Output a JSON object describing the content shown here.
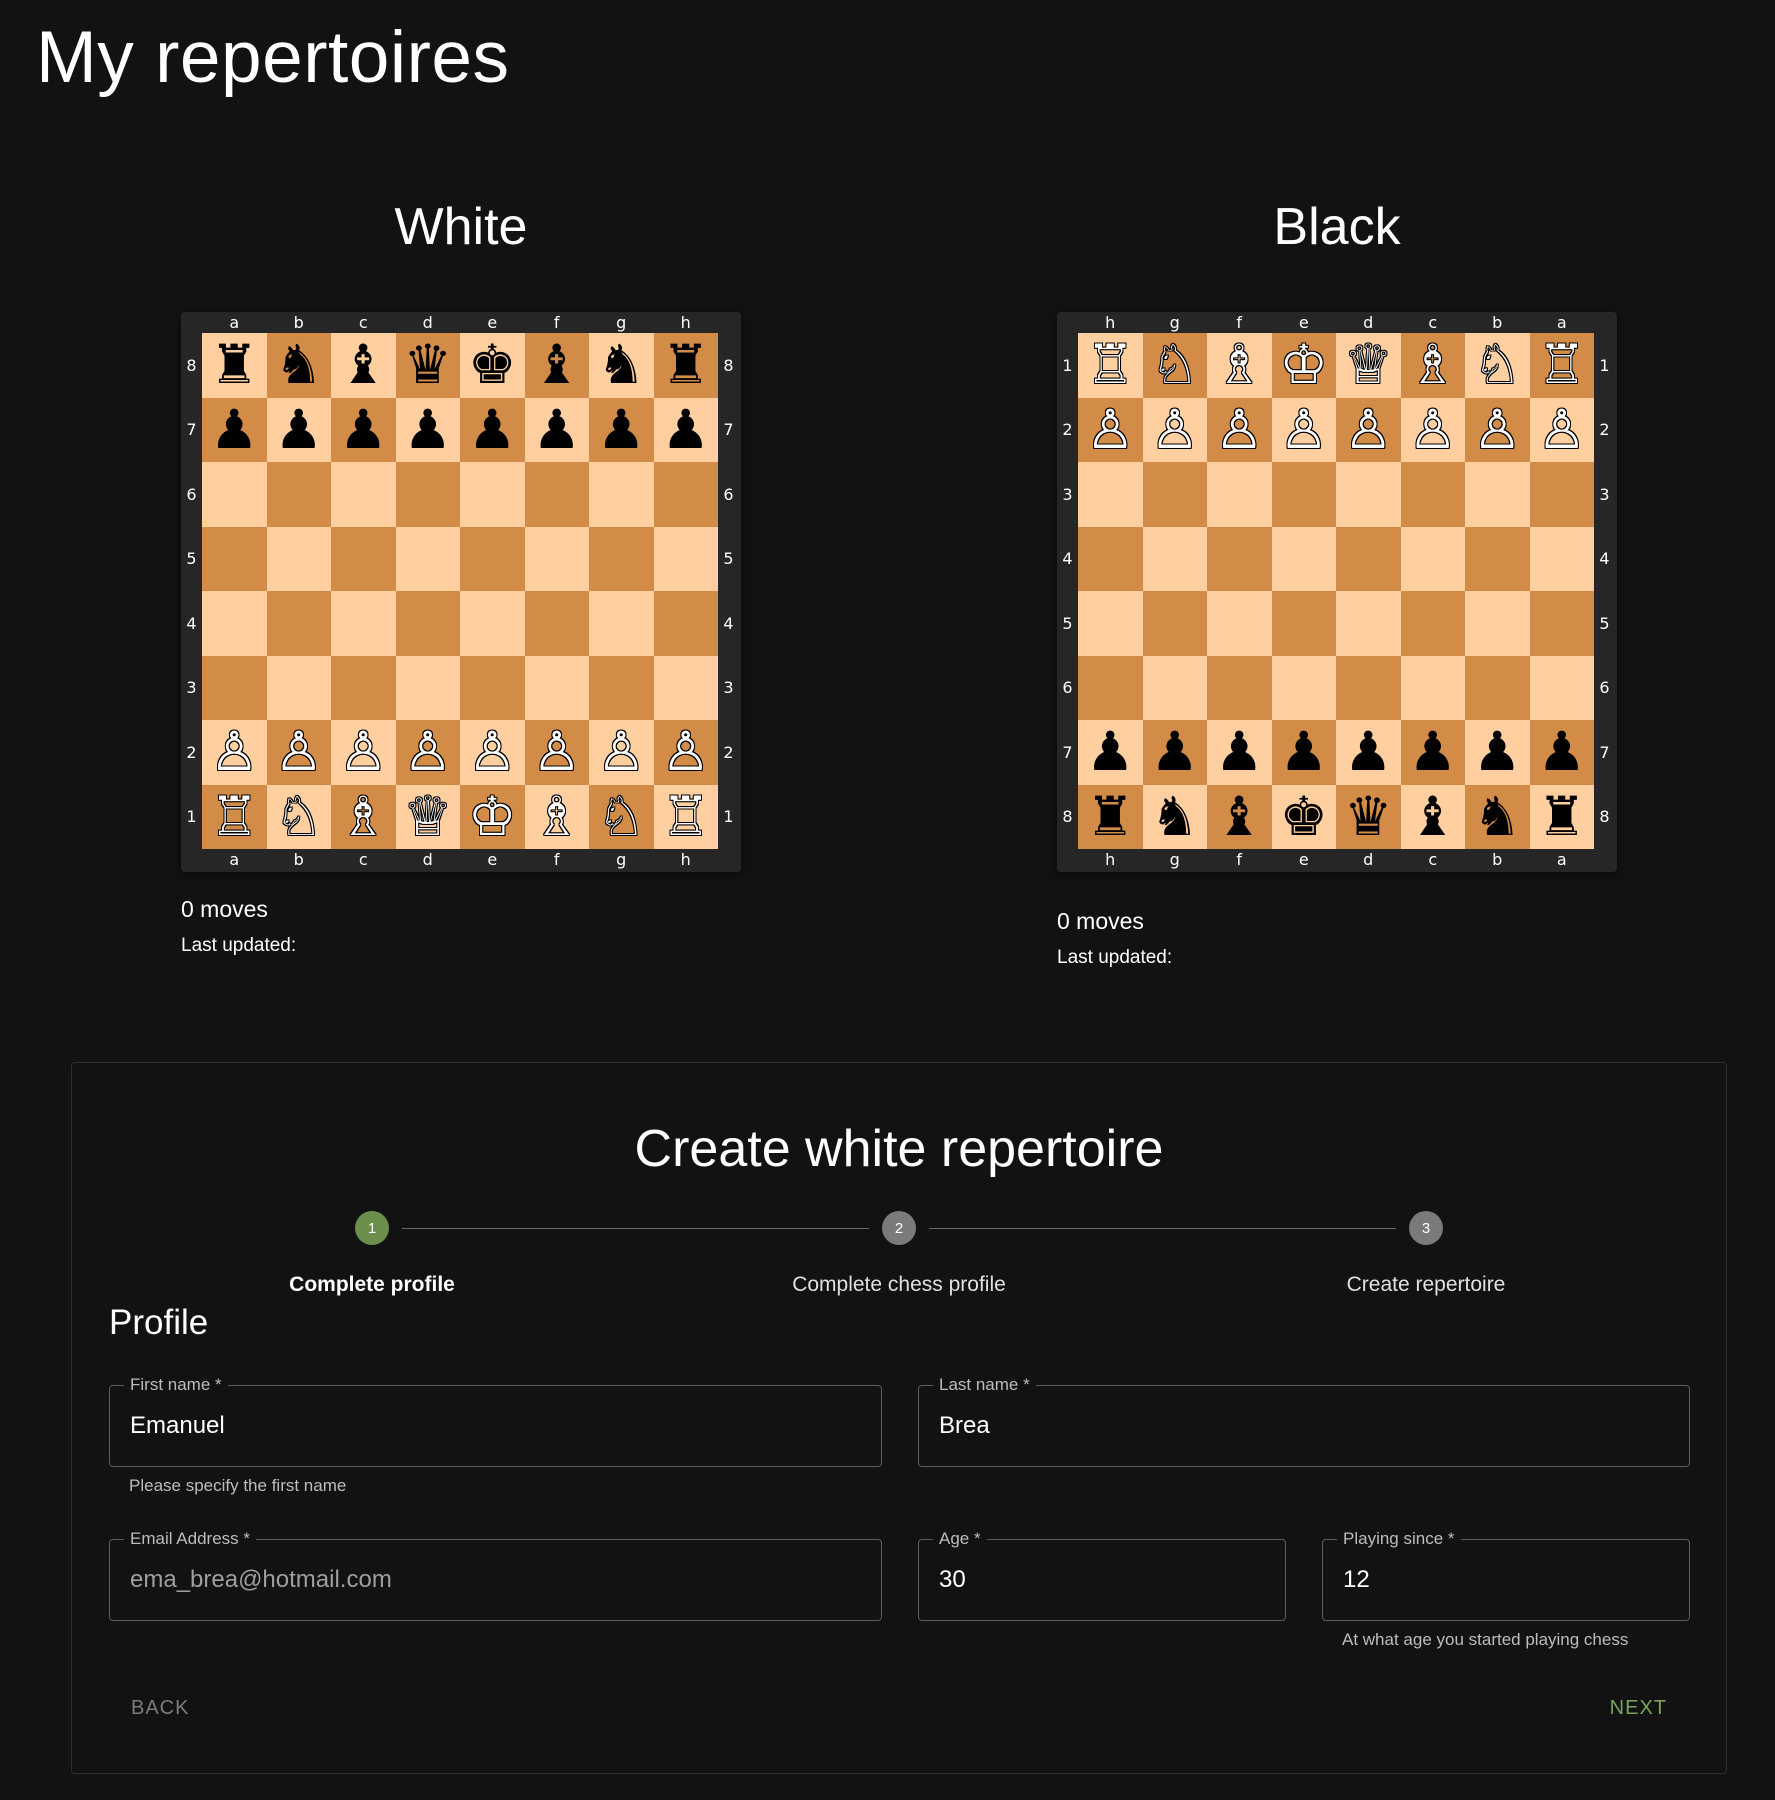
{
  "page": {
    "title": "My repertoires"
  },
  "repertoires": [
    {
      "id": "white",
      "title": "White",
      "orientation": "white",
      "files": [
        "a",
        "b",
        "c",
        "d",
        "e",
        "f",
        "g",
        "h"
      ],
      "ranks": [
        "8",
        "7",
        "6",
        "5",
        "4",
        "3",
        "2",
        "1"
      ],
      "position": [
        [
          "bR",
          "bN",
          "bB",
          "bQ",
          "bK",
          "bB",
          "bN",
          "bR"
        ],
        [
          "bP",
          "bP",
          "bP",
          "bP",
          "bP",
          "bP",
          "bP",
          "bP"
        ],
        [
          "",
          "",
          "",
          "",
          "",
          "",
          "",
          ""
        ],
        [
          "",
          "",
          "",
          "",
          "",
          "",
          "",
          ""
        ],
        [
          "",
          "",
          "",
          "",
          "",
          "",
          "",
          ""
        ],
        [
          "",
          "",
          "",
          "",
          "",
          "",
          "",
          ""
        ],
        [
          "wP",
          "wP",
          "wP",
          "wP",
          "wP",
          "wP",
          "wP",
          "wP"
        ],
        [
          "wR",
          "wN",
          "wB",
          "wQ",
          "wK",
          "wB",
          "wN",
          "wR"
        ]
      ],
      "moves": "0 moves",
      "last_updated": "Last updated:"
    },
    {
      "id": "black",
      "title": "Black",
      "orientation": "black",
      "files": [
        "h",
        "g",
        "f",
        "e",
        "d",
        "c",
        "b",
        "a"
      ],
      "ranks": [
        "1",
        "2",
        "3",
        "4",
        "5",
        "6",
        "7",
        "8"
      ],
      "position": [
        [
          "wR",
          "wN",
          "wB",
          "wK",
          "wQ",
          "wB",
          "wN",
          "wR"
        ],
        [
          "wP",
          "wP",
          "wP",
          "wP",
          "wP",
          "wP",
          "wP",
          "wP"
        ],
        [
          "",
          "",
          "",
          "",
          "",
          "",
          "",
          ""
        ],
        [
          "",
          "",
          "",
          "",
          "",
          "",
          "",
          ""
        ],
        [
          "",
          "",
          "",
          "",
          "",
          "",
          "",
          ""
        ],
        [
          "",
          "",
          "",
          "",
          "",
          "",
          "",
          ""
        ],
        [
          "bP",
          "bP",
          "bP",
          "bP",
          "bP",
          "bP",
          "bP",
          "bP"
        ],
        [
          "bR",
          "bN",
          "bB",
          "bK",
          "bQ",
          "bB",
          "bN",
          "bR"
        ]
      ],
      "moves": "0 moves",
      "last_updated": "Last updated:"
    }
  ],
  "create_form": {
    "title": "Create white repertoire",
    "steps": [
      {
        "number": "1",
        "label": "Complete profile",
        "active": true
      },
      {
        "number": "2",
        "label": "Complete chess profile",
        "active": false
      },
      {
        "number": "3",
        "label": "Create repertoire",
        "active": false
      }
    ],
    "section_heading": "Profile",
    "fields": {
      "first_name": {
        "label": "First name *",
        "value": "Emanuel",
        "helper": "Please specify the first name"
      },
      "last_name": {
        "label": "Last name *",
        "value": "Brea"
      },
      "email": {
        "label": "Email Address *",
        "value": "",
        "placeholder": "ema_brea@hotmail.com"
      },
      "age": {
        "label": "Age *",
        "value": "30"
      },
      "playing_since": {
        "label": "Playing since *",
        "value": "12",
        "helper": "At what age you started playing chess"
      }
    },
    "buttons": {
      "back": "BACK",
      "next": "NEXT"
    }
  },
  "colors": {
    "background": "#121212",
    "board_light": "#ffcf9f",
    "board_dark": "#d38c47",
    "active_step": "#6b8f4a",
    "inactive_step": "#7a7a7a",
    "next_button": "#7aa35a"
  },
  "piece_glyphs": {
    "wK": "♔",
    "wQ": "♕",
    "wR": "♖",
    "wB": "♗",
    "wN": "♘",
    "wP": "♙",
    "bK": "♚",
    "bQ": "♛",
    "bR": "♜",
    "bB": "♝",
    "bN": "♞",
    "bP": "♟"
  },
  "piece_names": {
    "K": "king",
    "Q": "queen",
    "R": "rook",
    "B": "bishop",
    "N": "knight",
    "P": "pawn"
  }
}
